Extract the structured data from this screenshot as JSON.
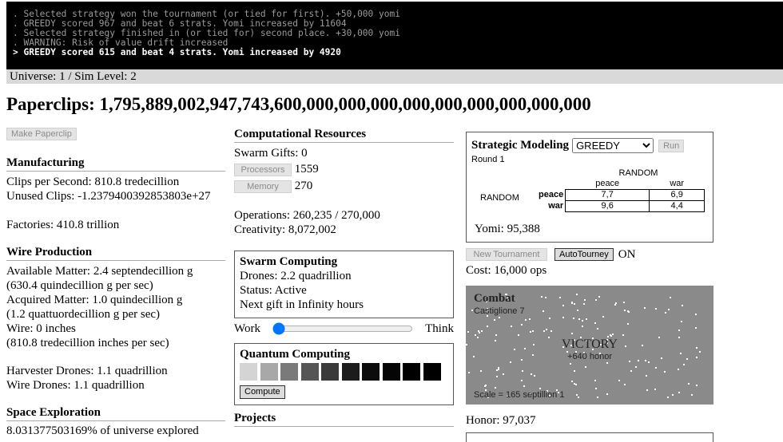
{
  "console": {
    "lines": [
      ". Selected strategy won the tournament (or tied for first). +50,000 yomi",
      ". GREEDY scored 967 and beat 6 strats. Yomi increased by 11604",
      ". Selected strategy finished in (or tied for) second place. +30,000 yomi",
      ". WARNING: Risk of value drift increased",
      "> GREEDY scored 615 and beat 4 strats. Yomi increased by 4920"
    ]
  },
  "universe_bar": "Universe: 1 / Sim Level: 2",
  "title": "Paperclips: 1,795,889,002,947,743,600,000,000,000,000,000,000,000,000,000",
  "make_paperclip": "Make Paperclip",
  "manufacturing": {
    "heading": "Manufacturing",
    "clips_per_second": "Clips per Second: 810.8 tredecillion",
    "unused_clips": "Unused Clips: -1.2379400392853803e+27",
    "factories": "Factories: 410.8 trillion"
  },
  "wire_production": {
    "heading": "Wire Production",
    "available_matter": "Available Matter: 2.4 septendecillion g",
    "available_rate": "(630.4 quindecillion g per sec)",
    "acquired_matter": "Acquired Matter: 1.0 quindecillion g",
    "acquired_rate": "(1.2 quattuordecillion g per sec)",
    "wire": "Wire: 0 inches",
    "wire_rate": "(810.8 tredecillion inches per sec)",
    "harvester_drones": "Harvester Drones: 1.1 quadrillion",
    "wire_drones": "Wire Drones: 1.1 quadrillion"
  },
  "space_exploration": {
    "heading": "Space Exploration",
    "explored": "8.031377503169% of universe explored"
  },
  "computational": {
    "heading": "Computational Resources",
    "swarm_gifts": "Swarm Gifts: 0",
    "processors_label": "Processors",
    "processors_value": "1559",
    "memory_label": "Memory",
    "memory_value": "270",
    "operations": "Operations: 260,235 / 270,000",
    "creativity": "Creativity: 8,072,002"
  },
  "swarm": {
    "heading": "Swarm Computing",
    "drones": "Drones: 2.2 quadrillion",
    "status": "Status: Active",
    "next_gift": "Next gift in Infinity hours",
    "work_label": "Work",
    "think_label": "Think",
    "slider_value": 0
  },
  "quantum": {
    "heading": "Quantum Computing",
    "compute_label": "Compute",
    "chip_colors": [
      "#d4d4d4",
      "#a8a8a8",
      "#7a7a7a",
      "#555555",
      "#3a3a3a",
      "#1c1c1c",
      "#0c0c0c",
      "#050505",
      "#000000",
      "#000000"
    ]
  },
  "projects_heading": "Projects",
  "strategic": {
    "heading": "Strategic Modeling",
    "selected_strategy": "GREEDY",
    "run_label": "Run",
    "round": "Round 1",
    "col_player": "RANDOM",
    "row_player": "RANDOM",
    "col_moves": [
      "peace",
      "war"
    ],
    "row_moves": [
      "peace",
      "war"
    ],
    "payoffs": [
      [
        "7,7",
        "6,9"
      ],
      [
        "9,6",
        "4,4"
      ]
    ],
    "yomi": "Yomi: 95,388"
  },
  "tournament": {
    "new_label": "New Tournament",
    "auto_label": "AutoTourney",
    "auto_state": "ON",
    "cost": "Cost: 16,000 ops"
  },
  "combat": {
    "heading": "Combat",
    "location": "Castiglione 7",
    "result": "VICTORY",
    "honor_gain": "+640 honor",
    "scale": "Scale = 165 septillion 1"
  },
  "honor": "Honor: 97,037"
}
